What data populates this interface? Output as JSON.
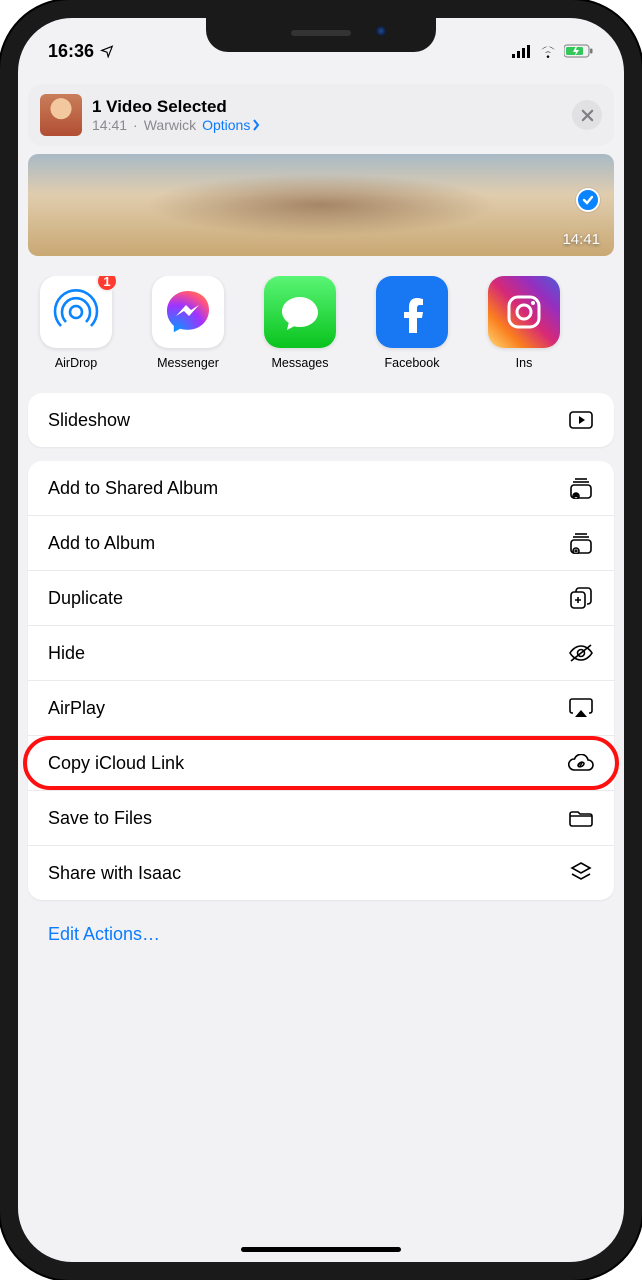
{
  "statusBar": {
    "time": "16:36"
  },
  "header": {
    "title": "1 Video Selected",
    "subtitle_time": "14:41",
    "subtitle_location": "Warwick",
    "options_label": "Options"
  },
  "videoStrip": {
    "duration": "14:41"
  },
  "apps": {
    "airdrop": {
      "label": "AirDrop",
      "badge": "1"
    },
    "messenger": {
      "label": "Messenger"
    },
    "messages": {
      "label": "Messages"
    },
    "facebook": {
      "label": "Facebook"
    },
    "instagram": {
      "label": "Ins"
    }
  },
  "actions": {
    "slideshow": "Slideshow",
    "add_shared": "Add to Shared Album",
    "add_album": "Add to Album",
    "duplicate": "Duplicate",
    "hide": "Hide",
    "airplay": "AirPlay",
    "copy_icloud": "Copy iCloud Link",
    "save_files": "Save to Files",
    "share_with": "Share with Isaac"
  },
  "edit_actions": "Edit Actions…"
}
